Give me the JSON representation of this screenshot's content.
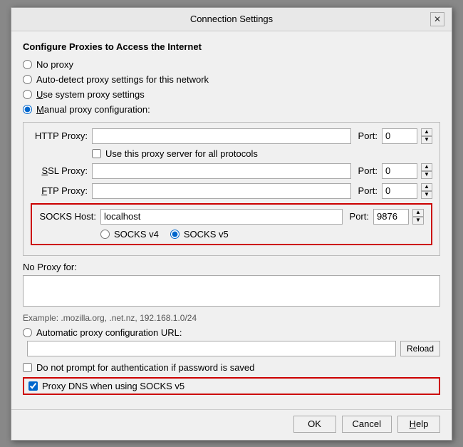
{
  "dialog": {
    "title": "Connection Settings",
    "close_label": "✕"
  },
  "section": {
    "heading": "Configure Proxies to Access the Internet"
  },
  "proxy_options": [
    {
      "id": "no_proxy",
      "label": "No proxy",
      "checked": false
    },
    {
      "id": "auto_detect",
      "label": "Auto-detect proxy settings for this network",
      "checked": false
    },
    {
      "id": "system_proxy",
      "label": "Use system proxy settings",
      "checked": false
    },
    {
      "id": "manual_proxy",
      "label": "Manual proxy configuration:",
      "checked": true
    }
  ],
  "http_proxy": {
    "label": "HTTP Proxy:",
    "value": "",
    "placeholder": "",
    "port_label": "Port:",
    "port_value": "0"
  },
  "use_all_protocols": {
    "label": "Use this proxy server for all protocols"
  },
  "ssl_proxy": {
    "label": "SSL Proxy:",
    "value": "",
    "port_label": "Port:",
    "port_value": "0"
  },
  "ftp_proxy": {
    "label": "FTP Proxy:",
    "value": "",
    "port_label": "Port:",
    "port_value": "0"
  },
  "socks_host": {
    "label": "SOCKS Host:",
    "value": "localhost",
    "port_label": "Port:",
    "port_value": "9876"
  },
  "socks_versions": [
    {
      "id": "socks4",
      "label": "SOCKS v4",
      "checked": false
    },
    {
      "id": "socks5",
      "label": "SOCKS v5",
      "checked": true
    }
  ],
  "no_proxy": {
    "label": "No Proxy for:",
    "value": ""
  },
  "example": {
    "text": "Example: .mozilla.org, .net.nz, 192.168.1.0/24"
  },
  "auto_proxy": {
    "label": "Automatic proxy configuration URL:",
    "value": "",
    "reload_label": "Reload"
  },
  "checkboxes": {
    "no_auth_prompt": {
      "label": "Do not prompt for authentication if password is saved",
      "checked": false
    },
    "proxy_dns": {
      "label": "Proxy DNS when using SOCKS v5",
      "checked": true
    }
  },
  "buttons": {
    "ok": "OK",
    "cancel": "Cancel",
    "help": "Help"
  }
}
